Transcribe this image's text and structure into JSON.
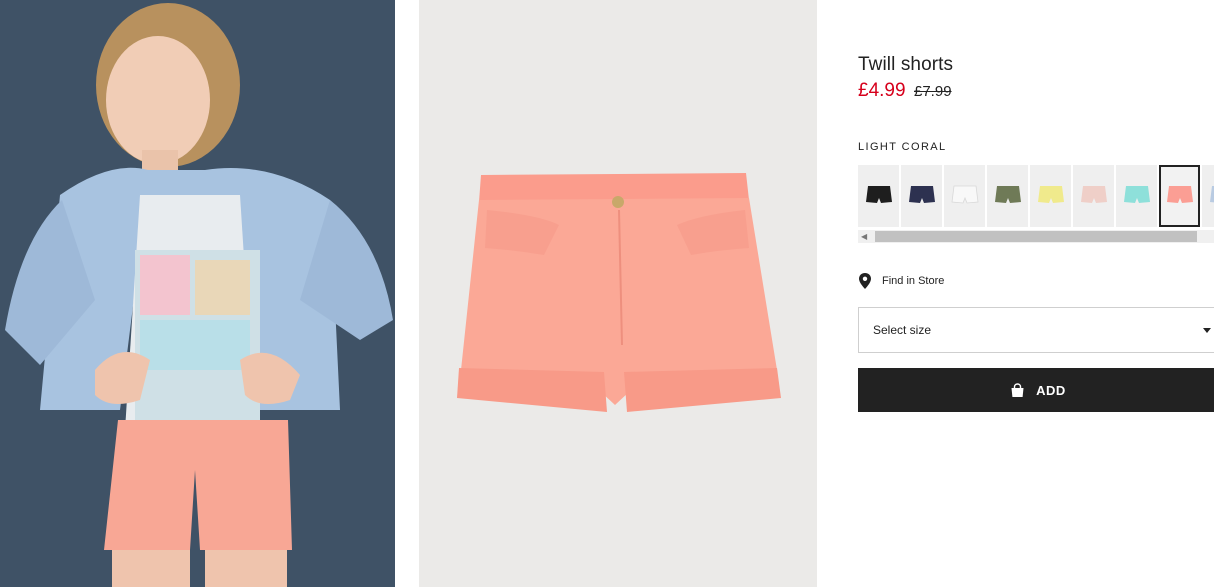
{
  "product": {
    "title": "Twill shorts",
    "price": "£4.99",
    "old_price": "£7.99",
    "color_label": "LIGHT CORAL"
  },
  "swatches": [
    {
      "name": "black",
      "color": "#1e1e1e"
    },
    {
      "name": "navy",
      "color": "#2d3150"
    },
    {
      "name": "white",
      "color": "#f8f8f8"
    },
    {
      "name": "khaki-green",
      "color": "#6f7a57"
    },
    {
      "name": "light-yellow",
      "color": "#f0ea8c"
    },
    {
      "name": "light-pink",
      "color": "#efcfc8"
    },
    {
      "name": "mint",
      "color": "#8ee0da"
    },
    {
      "name": "light-coral",
      "color": "#fb9e94",
      "selected": true
    },
    {
      "name": "light-blue",
      "color": "#b9cbe2"
    }
  ],
  "find_in_store": "Find in Store",
  "size_select": {
    "label": "Select size"
  },
  "add_button": {
    "label": "ADD"
  },
  "colors": {
    "sale_price": "#d6001c",
    "add_button_bg": "#222222",
    "product_bg": "#ebeae8",
    "model_bg": "#3f5266"
  }
}
